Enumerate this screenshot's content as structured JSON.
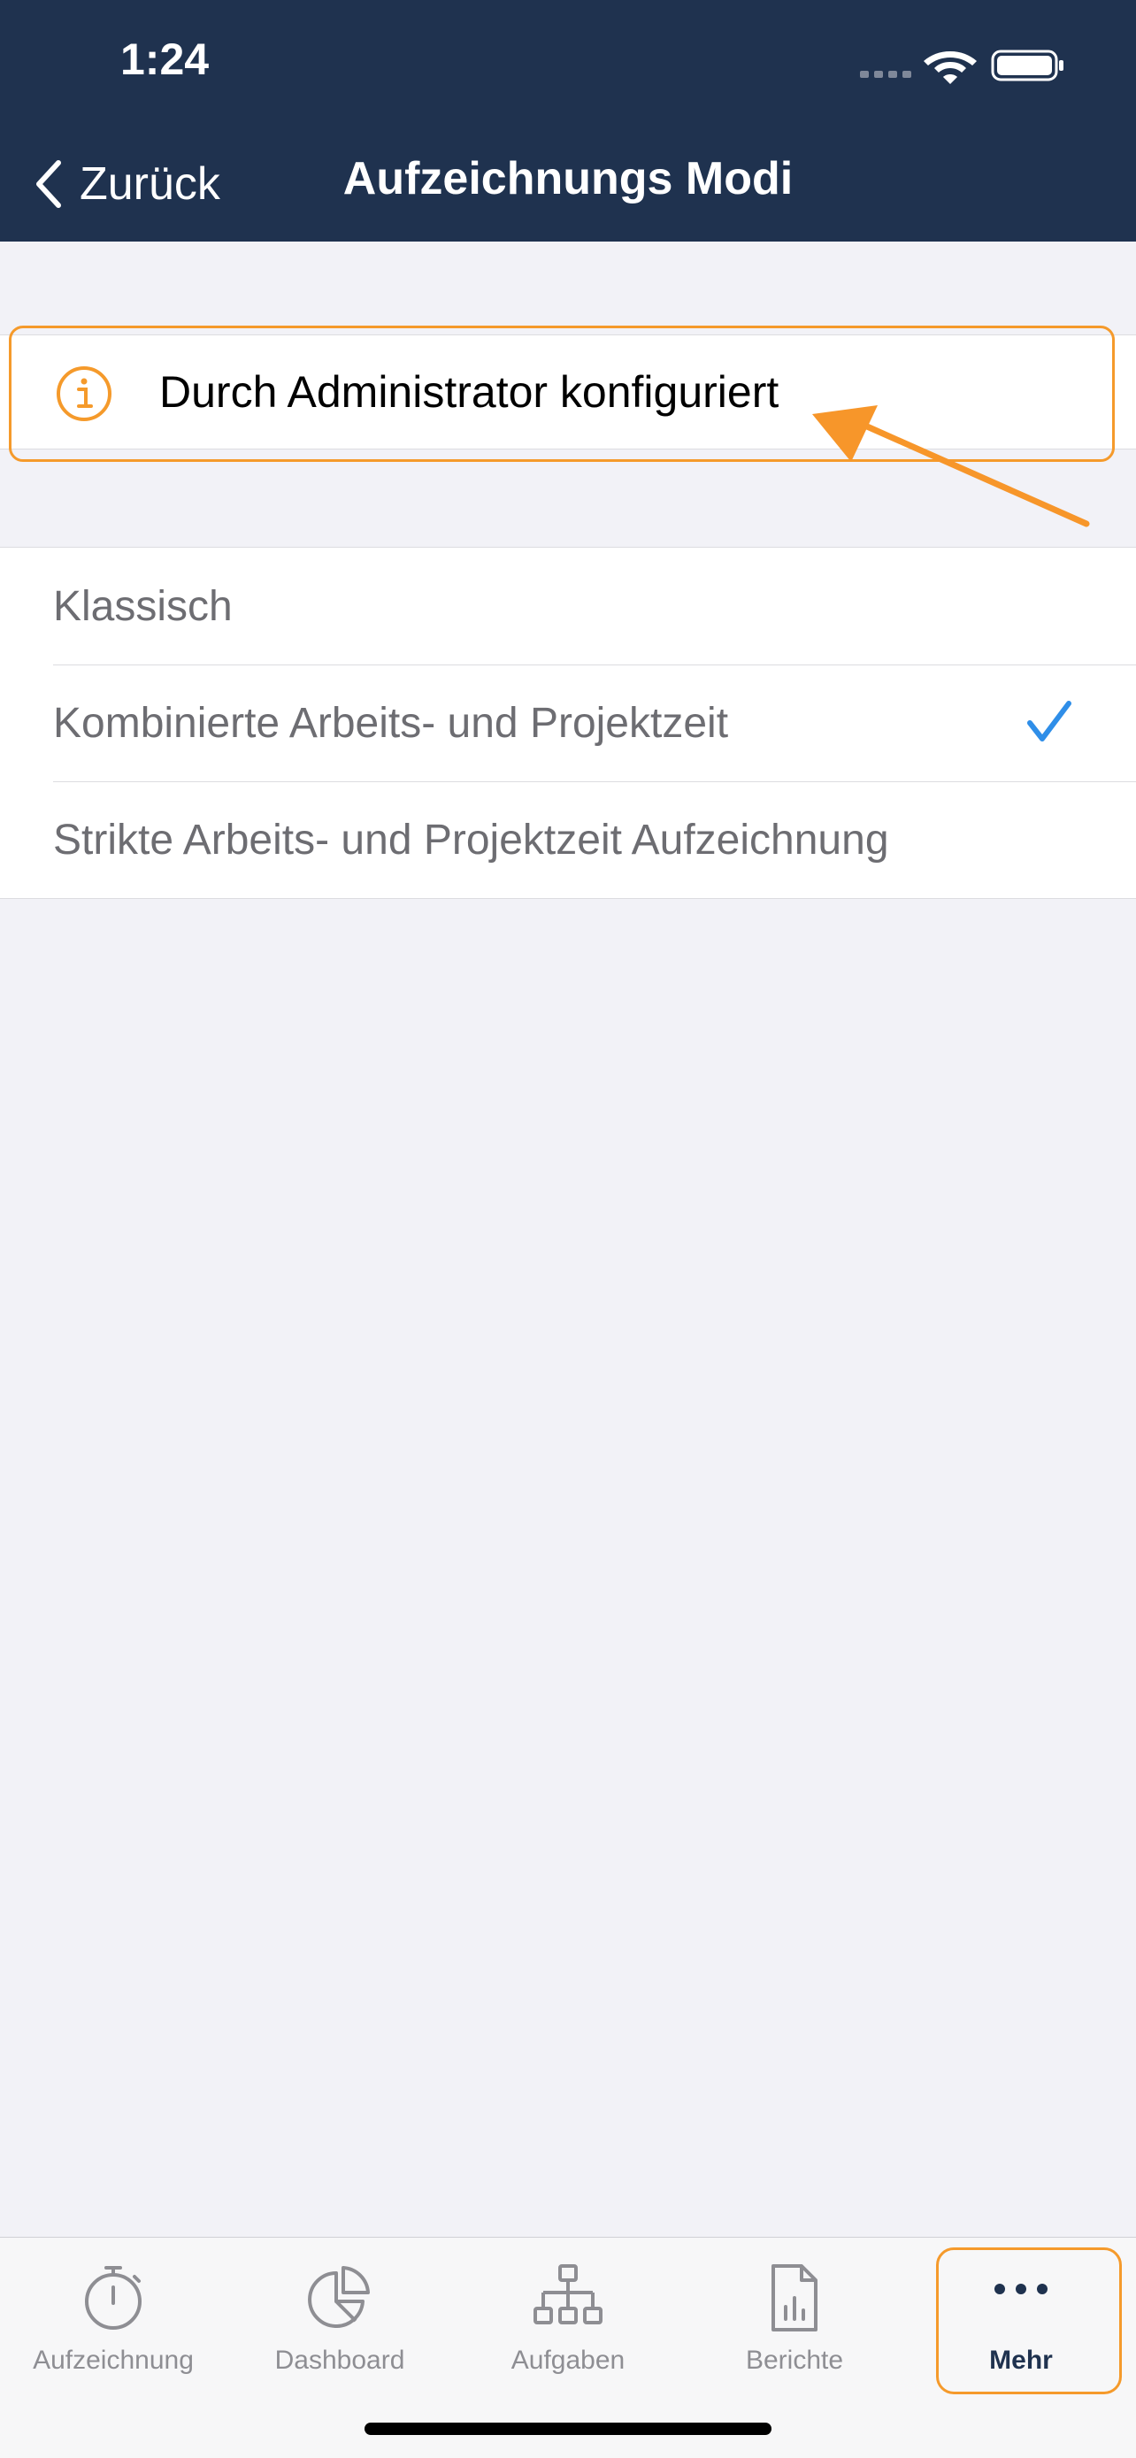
{
  "status_bar": {
    "time": "1:24"
  },
  "nav": {
    "back_label": "Zurück",
    "title": "Aufzeichnungs Modi"
  },
  "info": {
    "text": "Durch Administrator konfiguriert",
    "icon": "info-icon"
  },
  "modes": [
    {
      "label": "Klassisch",
      "selected": false
    },
    {
      "label": "Kombinierte Arbeits- und Projektzeit",
      "selected": true
    },
    {
      "label": "Strikte Arbeits- und Projektzeit Aufzeichnung",
      "selected": false
    }
  ],
  "tabs": [
    {
      "label": "Aufzeichnung",
      "icon": "stopwatch-icon"
    },
    {
      "label": "Dashboard",
      "icon": "pie-chart-icon"
    },
    {
      "label": "Aufgaben",
      "icon": "hierarchy-icon"
    },
    {
      "label": "Berichte",
      "icon": "report-icon"
    },
    {
      "label": "Mehr",
      "icon": "more-icon",
      "active": true
    }
  ],
  "colors": {
    "header": "#1f324f",
    "accent": "#f59a2b",
    "check": "#2f8ee8",
    "tab_inactive": "#8e8e93"
  }
}
